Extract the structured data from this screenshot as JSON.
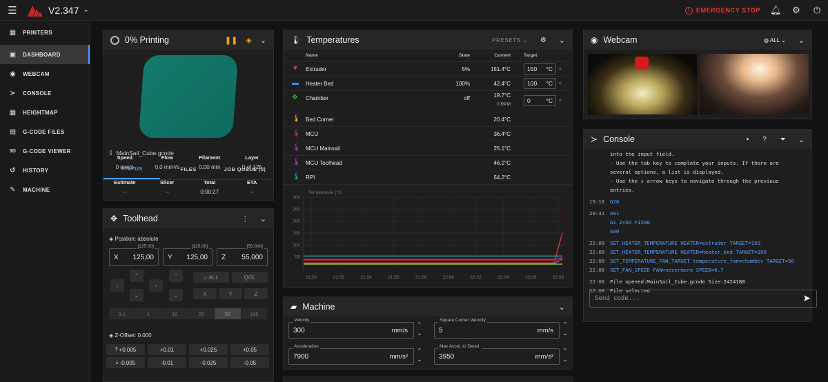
{
  "topbar": {
    "version": "V2.347",
    "emergency_stop": "EMERGENCY STOP"
  },
  "sidebar": {
    "items": [
      {
        "label": "PRINTERS",
        "icon": "printers-icon",
        "glyph": "▦"
      },
      {
        "label": "DASHBOARD",
        "icon": "dashboard-icon",
        "glyph": "▣"
      },
      {
        "label": "WEBCAM",
        "icon": "webcam-icon",
        "glyph": "◉"
      },
      {
        "label": "CONSOLE",
        "icon": "console-icon",
        "glyph": "≻"
      },
      {
        "label": "HEIGHTMAP",
        "icon": "heightmap-icon",
        "glyph": "▦"
      },
      {
        "label": "G-CODE FILES",
        "icon": "files-icon",
        "glyph": "▤"
      },
      {
        "label": "G-CODE VIEWER",
        "icon": "gcode-viewer-icon",
        "glyph": "3D"
      },
      {
        "label": "HISTORY",
        "icon": "history-icon",
        "glyph": "↺"
      },
      {
        "label": "MACHINE",
        "icon": "wrench-icon",
        "glyph": "✎"
      }
    ]
  },
  "status_panel": {
    "title": "0% Printing",
    "filename": "MainSail_Cube.gcode",
    "tabs": [
      "STATUS",
      "FILES",
      "JOB QUEUE (0)"
    ],
    "row1": [
      {
        "label": "Speed",
        "value": "0 mm/s"
      },
      {
        "label": "Flow",
        "value": "0.0 mm³/s"
      },
      {
        "label": "Filament",
        "value": "0.00 mm"
      },
      {
        "label": "Layer",
        "value": "0 of 125"
      }
    ],
    "row2": [
      {
        "label": "Estimate",
        "value": "--"
      },
      {
        "label": "Slicer",
        "value": "--"
      },
      {
        "label": "Total",
        "value": "0:00:27"
      },
      {
        "label": "ETA",
        "value": "--"
      }
    ]
  },
  "toolhead": {
    "title": "Toolhead",
    "position_label": "Position: absolute",
    "axes": [
      {
        "axis": "X",
        "value": "125,00",
        "cap": "[125.00]"
      },
      {
        "axis": "Y",
        "value": "125,00",
        "cap": "[125.00]"
      },
      {
        "axis": "Z",
        "value": "55,000",
        "cap": "[55.000]"
      }
    ],
    "home_all": "ALL",
    "qgl": "QGL",
    "home_x": "X",
    "home_y": "Y",
    "home_z": "Z",
    "steps": [
      "0.1",
      "1",
      "10",
      "25",
      "50",
      "100"
    ],
    "z_offset_label": "Z-Offset: 0.000",
    "z_up": [
      "+0.005",
      "+0.01",
      "+0.025",
      "+0.05"
    ],
    "z_down": [
      "-0.005",
      "-0.01",
      "-0.025",
      "-0.05"
    ]
  },
  "temperatures": {
    "title": "Temperatures",
    "presets": "PRESETS",
    "headers": {
      "name": "Name",
      "state": "State",
      "current": "Current",
      "target": "Target"
    },
    "rows": [
      {
        "name": "Extruder",
        "state": "5%",
        "current": "151.4°C",
        "target": "150",
        "unit": "°C",
        "color": "#e53935"
      },
      {
        "name": "Heater Bed",
        "state": "100%",
        "current": "42.4°C",
        "target": "100",
        "unit": "°C",
        "color": "#2196f3"
      },
      {
        "name": "Chamber",
        "state": "off",
        "current": "19.7°C",
        "sub": "0 RPM",
        "target": "0",
        "unit": "°C",
        "color": "#4caf50"
      },
      {
        "name": "Bed Corner",
        "current": "20.4°C",
        "color": "#fbc02d"
      },
      {
        "name": "MCU",
        "current": "36.4°C",
        "color": "#e53935"
      },
      {
        "name": "MCU Mainsail",
        "current": "25.1°C",
        "color": "#ab47bc"
      },
      {
        "name": "MCU Toolhead",
        "current": "46.2°C",
        "color": "#ab47bc"
      },
      {
        "name": "RPI",
        "current": "54.2°C",
        "color": "#26a69a"
      }
    ]
  },
  "chart_data": {
    "type": "line",
    "ylabel": "Temperature [°C]",
    "ylim": [
      0,
      300
    ],
    "yticks": [
      300,
      250,
      200,
      150,
      100,
      50
    ],
    "x": [
      "21:50",
      "21:52",
      "21:54",
      "21:56",
      "21:58",
      "22:00",
      "22:02",
      "22:04",
      "22:06",
      "22:08"
    ],
    "series": [
      {
        "name": "Extruder",
        "color": "#e53935",
        "values": [
          25,
          25,
          25,
          25,
          25,
          25,
          25,
          25,
          25,
          150
        ]
      },
      {
        "name": "Heater Bed",
        "color": "#2196f3",
        "values": [
          22,
          22,
          22,
          22,
          22,
          22,
          22,
          22,
          22,
          42
        ]
      },
      {
        "name": "RPI",
        "color": "#26a69a",
        "values": [
          54,
          54,
          54,
          54,
          54,
          54,
          54,
          54,
          54,
          54
        ]
      },
      {
        "name": "MCU Toolhead",
        "color": "#ab47bc",
        "values": [
          40,
          40,
          40,
          40,
          40,
          40,
          40,
          40,
          40,
          46
        ]
      },
      {
        "name": "MCU",
        "color": "#b71c1c",
        "values": [
          36,
          36,
          36,
          36,
          36,
          36,
          36,
          36,
          36,
          36
        ]
      },
      {
        "name": "Chamber",
        "color": "#8bc34a",
        "values": [
          20,
          20,
          20,
          20,
          20,
          20,
          20,
          20,
          20,
          20
        ]
      }
    ]
  },
  "machine": {
    "title": "Machine",
    "fields": [
      {
        "label": "Velocity",
        "value": "300",
        "unit": "mm/s"
      },
      {
        "label": "Square Corner Velocity",
        "value": "5",
        "unit": "mm/s"
      },
      {
        "label": "Acceleration",
        "value": "7900",
        "unit": "mm/s²"
      },
      {
        "label": "Max Accel. to Decel.",
        "value": "3950",
        "unit": "mm/s²"
      }
    ]
  },
  "webcam": {
    "title": "Webcam",
    "filter": "ALL"
  },
  "console": {
    "title": "Console",
    "help_lines": [
      "into the input field.",
      "- Use the tab key to complete your inputs. If there are",
      "several options, a list is displayed.",
      "- Use the ↕ arrow keys to navigate through the previous",
      "entries."
    ],
    "entries": [
      {
        "time": "19:18",
        "text": "G28",
        "cmd": true
      },
      {
        "time": "20:31",
        "text": "G91",
        "cmd": true
      },
      {
        "time": "",
        "text": "G1 Z+50 F1500",
        "cmd": true
      },
      {
        "time": "",
        "text": "G90",
        "cmd": true
      },
      {
        "time": "22:08",
        "text": "SET_HEATER_TEMPERATURE HEATER=extruder TARGET=150",
        "cmd": true
      },
      {
        "time": "22:08",
        "text": "SET_HEATER_TEMPERATURE HEATER=heater_bed TARGET=100",
        "cmd": true
      },
      {
        "time": "22:08",
        "text": "SET_TEMPERATURE_FAN_TARGET temperature_fan=chamber TARGET=50",
        "cmd": true
      },
      {
        "time": "22:08",
        "text": "SET_FAN_SPEED FAN=nevermore SPEED=0.7",
        "cmd": true
      },
      {
        "time": "22:08",
        "text": "File opened:MainSail_Cube.gcode Size:2424180",
        "cmd": false
      },
      {
        "time": "22:08",
        "text": "File selected",
        "cmd": false
      }
    ],
    "placeholder": "Send code..."
  }
}
